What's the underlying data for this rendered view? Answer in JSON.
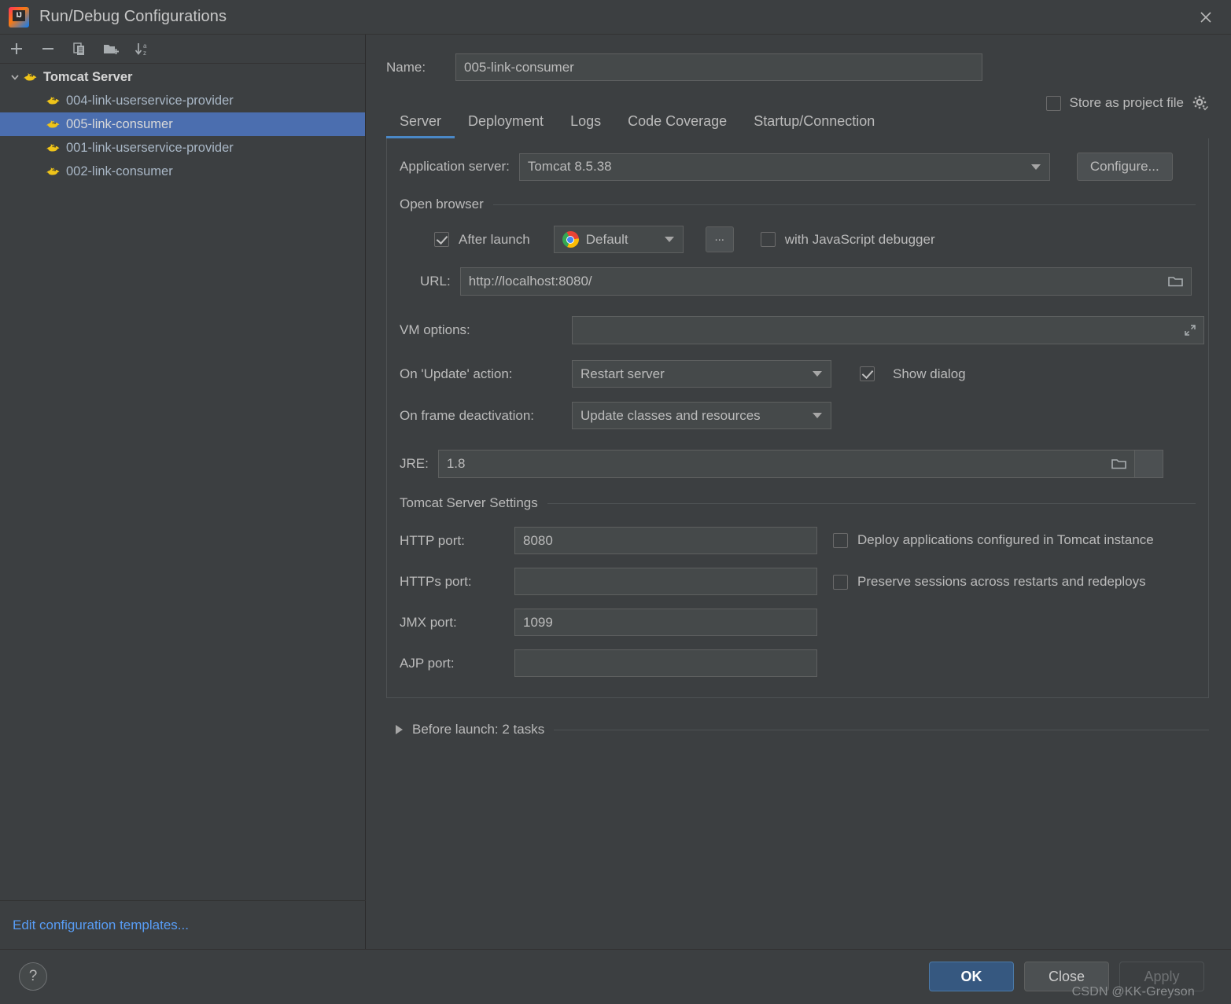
{
  "window": {
    "title": "Run/Debug Configurations",
    "logo_icon": "intellij-idea-logo",
    "close_icon": "close-icon"
  },
  "toolbar": {
    "add": {
      "icon": "plus-icon",
      "label": "+"
    },
    "remove": {
      "icon": "minus-icon",
      "label": "−"
    },
    "copy": {
      "icon": "copy-icon"
    },
    "new_folder": {
      "icon": "new-folder-icon"
    },
    "sort": {
      "icon": "sort-alphabetically-icon"
    }
  },
  "tree": {
    "group": {
      "label": "Tomcat Server",
      "icon": "tomcat-icon",
      "expanded": true,
      "arrow_icon": "chevron-down-icon"
    },
    "items": [
      {
        "label": "004-link-userservice-provider",
        "icon": "tomcat-icon",
        "selected": false
      },
      {
        "label": "005-link-consumer",
        "icon": "tomcat-icon",
        "selected": true
      },
      {
        "label": "001-link-userservice-provider",
        "icon": "tomcat-icon",
        "selected": false
      },
      {
        "label": "002-link-consumer",
        "icon": "tomcat-icon",
        "selected": false
      }
    ]
  },
  "edit_templates_link": "Edit configuration templates...",
  "name_field": {
    "label": "Name:",
    "value": "005-link-consumer"
  },
  "store_as_project_file": {
    "label": "Store as project file",
    "checked": false,
    "gear_icon": "gear-icon"
  },
  "tabs": [
    {
      "label": "Server",
      "active": true
    },
    {
      "label": "Deployment",
      "active": false
    },
    {
      "label": "Logs",
      "active": false
    },
    {
      "label": "Code Coverage",
      "active": false
    },
    {
      "label": "Startup/Connection",
      "active": false
    }
  ],
  "server_tab": {
    "application_server": {
      "label": "Application server:",
      "value": "Tomcat 8.5.38",
      "configure_button": "Configure..."
    },
    "open_browser": {
      "group_label": "Open browser",
      "after_launch": {
        "label": "After launch",
        "checked": true
      },
      "browser": {
        "value": "Default",
        "icon": "chrome-icon"
      },
      "more_button": "...",
      "js_debugger": {
        "label": "with JavaScript debugger",
        "checked": false
      },
      "url": {
        "label": "URL:",
        "value": "http://localhost:8080/",
        "browse_icon": "folder-icon"
      }
    },
    "vm_options": {
      "label": "VM options:",
      "value": "",
      "expand_icon": "expand-icon"
    },
    "on_update_action": {
      "label": "On 'Update' action:",
      "value": "Restart server"
    },
    "show_dialog": {
      "label": "Show dialog",
      "checked": true
    },
    "on_frame_deactivation": {
      "label": "On frame deactivation:",
      "value": "Update classes and resources"
    },
    "jre": {
      "label": "JRE:",
      "value": "1.8",
      "browse_icon": "folder-icon",
      "dropdown_icon": "chevron-down-icon"
    },
    "tomcat_settings": {
      "group_label": "Tomcat Server Settings",
      "ports": [
        {
          "label": "HTTP port:",
          "value": "8080"
        },
        {
          "label": "HTTPs port:",
          "value": ""
        },
        {
          "label": "JMX port:",
          "value": "1099"
        },
        {
          "label": "AJP port:",
          "value": ""
        }
      ],
      "options": [
        {
          "label": "Deploy applications configured in Tomcat instance",
          "checked": false
        },
        {
          "label": "Preserve sessions across restarts and redeploys",
          "checked": false
        }
      ]
    }
  },
  "before_launch": {
    "label": "Before launch: 2 tasks",
    "expanded": false,
    "arrow_icon": "chevron-right-icon"
  },
  "footer": {
    "help": {
      "label": "?",
      "icon": "help-icon"
    },
    "ok": "OK",
    "close": "Close",
    "apply": "Apply",
    "apply_disabled": true
  },
  "watermark": "CSDN @KK-Greyson",
  "colors": {
    "background": "#3c3f41",
    "selection": "#4b6eaf",
    "accent": "#4a88c7",
    "link": "#589df6",
    "primary_button": "#365880",
    "field_background": "#45494a"
  }
}
